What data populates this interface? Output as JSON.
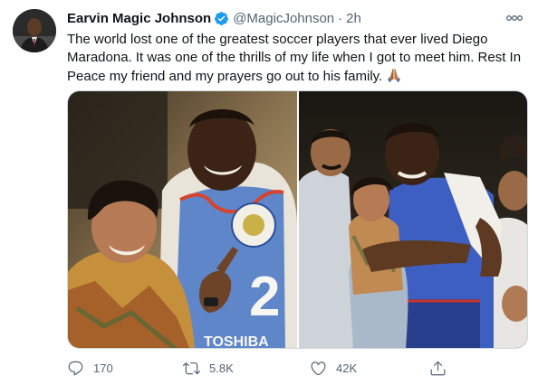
{
  "author": {
    "display_name": "Earvin Magic Johnson",
    "handle": "@MagicJohnson",
    "separator": "·",
    "time": "2h",
    "verified": true
  },
  "tweet": {
    "text": "The world lost one of the greatest soccer players that ever lived Diego Maradona. It was one of the thrills of my life when I got to meet him. Rest In Peace my friend and my prayers go out to his family.",
    "emoji": "folded-hands"
  },
  "photos": [
    {
      "jersey_number": "2",
      "jersey_sponsor": "TOSHIBA"
    },
    {
      "jersey_number": "",
      "jersey_sponsor": ""
    }
  ],
  "actions": {
    "reply_count": "170",
    "retweet_count": "5.8K",
    "like_count": "42K"
  },
  "icons": [
    "verified-badge-icon",
    "more-icon",
    "reply-icon",
    "retweet-icon",
    "like-icon",
    "share-icon",
    "folded-hands-icon"
  ],
  "colors": {
    "text": "#0f1419",
    "secondary": "#536471",
    "verified": "#1d9bf0",
    "border": "#cfd9de"
  }
}
